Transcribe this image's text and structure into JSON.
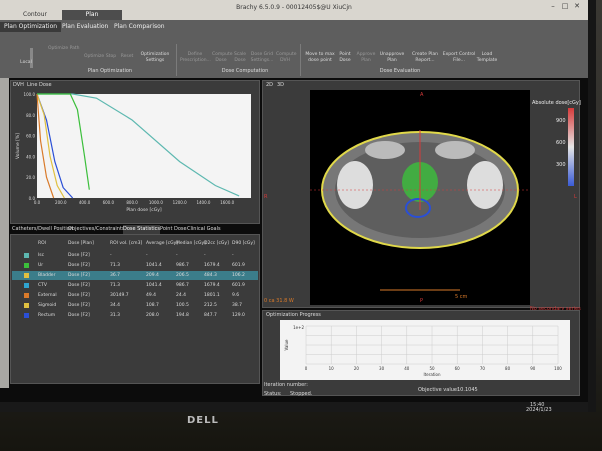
{
  "window": {
    "title": "Brachy 6.5.0.9 - 00012405$@U XiuCjn",
    "top_tabs": [
      "Contour",
      "Plan"
    ],
    "active_top_tab": "Plan"
  },
  "ribbon": {
    "tabs": [
      "Plan Optimization",
      "Plan Evaluation",
      "Plan Comparison"
    ],
    "active_tab": "Plan Optimization",
    "left_group": {
      "checkbox": "Optimize Path",
      "slider_label": "Local",
      "buttons": [
        "Optimize",
        "Stop",
        "Reset",
        "Optimization Settings"
      ],
      "group_label": "Plan Optimization"
    },
    "dose_computation": {
      "buttons": [
        "Define Prescription...",
        "Compute Dose",
        "Scale Dose",
        "Dose Grid Settings...",
        "Compute DVH"
      ],
      "group_label": "Dose Computation"
    },
    "dose_evaluation": {
      "buttons": [
        "Move to max dose point",
        "Point Dose",
        "Approve Plan",
        "Unapprove Plan",
        "Create Plan Report...",
        "Export Control File...",
        "Load Template"
      ],
      "group_label": "Dose Evaluation"
    }
  },
  "dvh_panel": {
    "tabs": [
      "DVH",
      "Line Dose"
    ],
    "ylabel": "Volume [%]",
    "xlabel": "Plan dose [cGy]"
  },
  "chart_data": {
    "type": "line",
    "xlabel": "Plan dose [cGy]",
    "ylabel": "Volume [%]",
    "xlim": [
      0,
      1800
    ],
    "ylim": [
      0,
      100
    ],
    "x_ticks": [
      "0.0",
      "200.0",
      "400.0",
      "600.0",
      "800.0",
      "1000.0",
      "1200.0",
      "1400.0",
      "1600.0"
    ],
    "y_ticks": [
      "0.0",
      "20.0",
      "40.0",
      "60.0",
      "80.0",
      "100.0"
    ],
    "series": [
      {
        "name": "Bladder",
        "color": "#5db8b0",
        "x": [
          0,
          300,
          500,
          800,
          1200,
          1500,
          1700
        ],
        "y": [
          100,
          100,
          96,
          75,
          35,
          12,
          2
        ]
      },
      {
        "name": "Rectum",
        "color": "#2a4fd6",
        "x": [
          0,
          80,
          150,
          220,
          300
        ],
        "y": [
          100,
          75,
          35,
          10,
          0
        ]
      },
      {
        "name": "Sigmoid",
        "color": "#e0c040",
        "x": [
          0,
          60,
          110,
          170,
          230
        ],
        "y": [
          100,
          80,
          40,
          12,
          0
        ]
      },
      {
        "name": "External",
        "color": "#d97a2a",
        "x": [
          0,
          30,
          80,
          140
        ],
        "y": [
          100,
          55,
          20,
          0
        ]
      },
      {
        "name": "CTV",
        "color": "#3bbf3b",
        "x": [
          0,
          280,
          340,
          400,
          440
        ],
        "y": [
          100,
          100,
          85,
          40,
          8
        ]
      }
    ]
  },
  "image_panel": {
    "tabs": [
      "2D",
      "3D"
    ],
    "orientation_labels": [
      "A",
      "P",
      "R",
      "L"
    ],
    "scale_label": "5 cm",
    "legend_title": "Absolute dose[cGy]",
    "legend_values": [
      "900",
      "600",
      "300"
    ],
    "bottom_left": "0 ca 31.8 W",
    "bottom_right": "No secondary series"
  },
  "table_panel": {
    "tabs": [
      "Catheters/Dwell Position",
      "Objectives/Constraints",
      "Dose Statistics",
      "Point Dose",
      "Clinical Goals"
    ],
    "active_tab": "Dose Statistics",
    "columns": [
      "ROI",
      "Dose [Plan]",
      "ROI vol. [cm3]",
      "Average [cGy]",
      "Median [cGy]",
      "D2cc [cGy]",
      "D90 [cGy]"
    ],
    "rows": [
      {
        "color": "#5db8b0",
        "roi": "lsc",
        "dose": "Dose [F2]",
        "vol": "-",
        "avg": "-",
        "med": "-",
        "d2": "-",
        "d90": "-"
      },
      {
        "color": "#3bbf3b",
        "roi": "Ur",
        "dose": "Dose [F2]",
        "vol": "71.3",
        "avg": "1041.4",
        "med": "986.7",
        "d2": "1679.4",
        "d90": "601.9"
      },
      {
        "color": "#e0c040",
        "roi": "Bladder",
        "dose": "Dose [F2]",
        "vol": "36.7",
        "avg": "209.4",
        "med": "206.5",
        "d2": "484.3",
        "d90": "106.2"
      },
      {
        "color": "#2fa4d0",
        "roi": "CTV",
        "dose": "Dose [F2]",
        "vol": "71.3",
        "avg": "1041.4",
        "med": "986.7",
        "d2": "1679.4",
        "d90": "601.9"
      },
      {
        "color": "#d97a2a",
        "roi": "External",
        "dose": "Dose [F2]",
        "vol": "30149.7",
        "avg": "49.4",
        "med": "24.4",
        "d2": "1801.1",
        "d90": "9.6"
      },
      {
        "color": "#e0c040",
        "roi": "Sigmoid",
        "dose": "Dose [F2]",
        "vol": "34.4",
        "avg": "108.7",
        "med": "100.5",
        "d2": "212.5",
        "d90": "38.7"
      },
      {
        "color": "#2a4fd6",
        "roi": "Rectum",
        "dose": "Dose [F2]",
        "vol": "31.3",
        "avg": "208.0",
        "med": "194.8",
        "d2": "847.7",
        "d90": "129.0"
      }
    ]
  },
  "optimization_progress": {
    "title": "Optimization Progress",
    "ylabel": "Value",
    "xlabel": "Iteration",
    "x_ticks": [
      "0",
      "10",
      "20",
      "30",
      "40",
      "50",
      "60",
      "70",
      "80",
      "90",
      "100"
    ],
    "y_top": "1e+2",
    "iteration_label": "Iteration number:",
    "iteration_value": "",
    "objective_label": "Objective value:",
    "objective_value": "10.1045",
    "status_label": "Status:",
    "status_value": "Stopped."
  },
  "taskbar": {
    "time": "15:40",
    "date": "2024/1/23"
  },
  "brand": "DELL"
}
